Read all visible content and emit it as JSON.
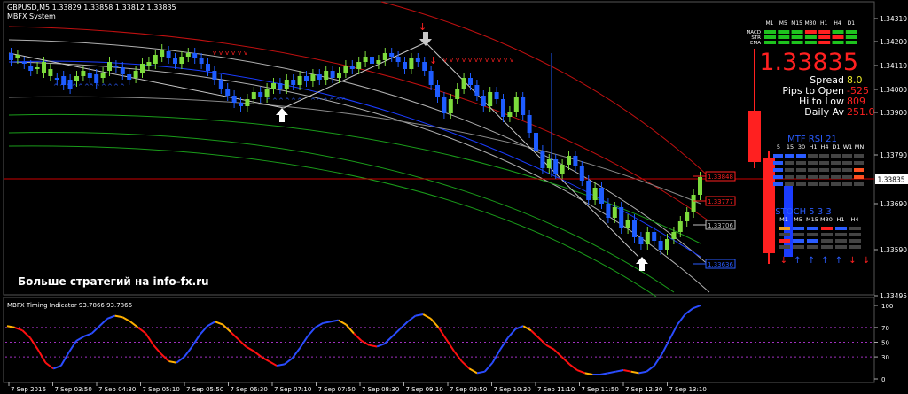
{
  "main": {
    "header_line": "GBPUSD,M5  1.33829 1.33858 1.33812 1.33835",
    "indicator_name": "MBFX System",
    "watermark": "Больше стратегий на info-fx.ru",
    "price_axis": [
      "1.34310",
      "1.34200",
      "1.34110",
      "1.34000",
      "1.33900",
      "1.33790",
      "1.33690",
      "1.33590",
      "1.33495"
    ],
    "current_price_tag": "1.33835",
    "channel_labels": [
      {
        "text": "1.33848",
        "color": "#ff2020"
      },
      {
        "text": "1.33777",
        "color": "#ff2020"
      },
      {
        "text": "1.33706",
        "color": "#c0c0c0"
      },
      {
        "text": "1.33636",
        "color": "#2a5cff"
      }
    ]
  },
  "panel": {
    "tf_header": [
      "M1",
      "M5",
      "M15",
      "M30",
      "H1",
      "H4",
      "D1"
    ],
    "rows": [
      {
        "label": "MACD",
        "colors": [
          "#1ec31e",
          "#1ec31e",
          "#1ec31e",
          "#ff2020",
          "#ff2020",
          "#1ec31e",
          "#1ec31e"
        ]
      },
      {
        "label": "STR",
        "colors": [
          "#1ec31e",
          "#1ec31e",
          "#1ec31e",
          "#1ec31e",
          "#ff2020",
          "#ff2020",
          "#1ec31e"
        ]
      },
      {
        "label": "EMA",
        "colors": [
          "#1ec31e",
          "#1ec31e",
          "#1ec31e",
          "#1ec31e",
          "#ff2020",
          "#1ec31e",
          "#1ec31e"
        ]
      }
    ],
    "big_price": "1.33835",
    "stats": [
      {
        "label": "Spread",
        "value": "8.0"
      },
      {
        "label": "Pips to Open",
        "value": "-525"
      },
      {
        "label": "Hi to Low",
        "value": "809"
      },
      {
        "label": "Daily Av",
        "value": "251.0"
      }
    ],
    "rsi_title": "MTF RSI  21",
    "rsi_tf": [
      "5",
      "15",
      "30",
      "H1",
      "H4",
      "D1",
      "W1",
      "MN"
    ],
    "stoch_title": "STOCH  5 3 3",
    "stoch_tf": [
      "M1",
      "M5",
      "M15",
      "M30",
      "H1",
      "H4"
    ],
    "arrows": [
      "down",
      "up",
      "up",
      "up",
      "up",
      "down",
      "down"
    ],
    "arrow_up_color": "#2a5cff",
    "arrow_down_color": "#ff2020"
  },
  "sub": {
    "title": "MBFX Timing Indicator 93.7866 93.7866",
    "axis": [
      "100",
      "70",
      "50",
      "30",
      "0"
    ]
  },
  "time_axis": [
    "7 Sep 2016",
    "7 Sep 03:50",
    "7 Sep 04:30",
    "7 Sep 05:10",
    "7 Sep 05:50",
    "7 Sep 06:30",
    "7 Sep 07:10",
    "7 Sep 07:50",
    "7 Sep 08:30",
    "7 Sep 09:10",
    "7 Sep 09:50",
    "7 Sep 10:30",
    "7 Sep 11:10",
    "7 Sep 11:50",
    "7 Sep 12:30",
    "7 Sep 13:10"
  ],
  "colors": {
    "bull": "#7ddc3c",
    "bear": "#1e5cff",
    "red": "#ff2020",
    "blue": "#2a5cff",
    "grid": "#5a5a5a"
  }
}
